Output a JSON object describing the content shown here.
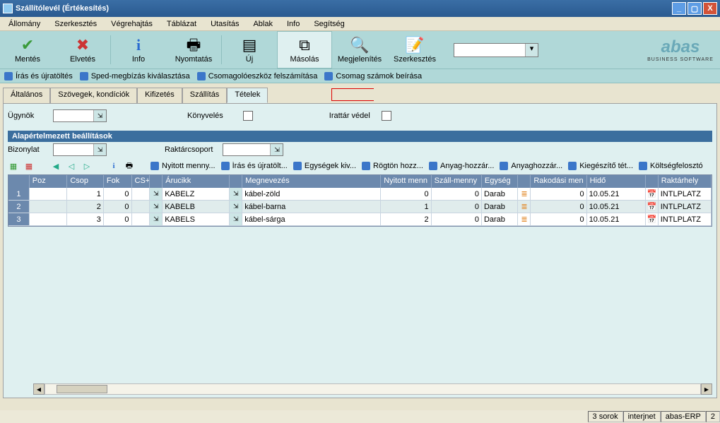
{
  "window": {
    "title": "Szállítólevél (Értékesítés)"
  },
  "menu": {
    "items": [
      "Állomány",
      "Szerkesztés",
      "Végrehajtás",
      "Táblázat",
      "Utasítás",
      "Ablak",
      "Info",
      "Segítség"
    ]
  },
  "toolbar": {
    "save": "Mentés",
    "discard": "Elvetés",
    "info": "Info",
    "print": "Nyomtatás",
    "new": "Új",
    "copy": "Másolás",
    "show": "Megjelenítés",
    "edit": "Szerkesztés"
  },
  "logo": {
    "brand": "abas",
    "sub": "BUSINESS SOFTWARE"
  },
  "ribbon": [
    "Írás és újratöltés",
    "Sped-megbízás kiválasztása",
    "Csomagolóeszköz felszámítása",
    "Csomag számok beírása"
  ],
  "tabs": {
    "items": [
      "Általános",
      "Szövegek, kondíciók",
      "Kifizetés",
      "Szállítás",
      "Tételek"
    ],
    "activeIndex": 4
  },
  "form": {
    "agent_label": "Ügynök",
    "agent_value": "",
    "booking_label": "Könyvelés",
    "archive_label": "Irattár védel",
    "section": "Alapértelmezett beállítások",
    "doc_label": "Bizonylat",
    "doc_value": "",
    "wh_label": "Raktárcsoport",
    "wh_value": ""
  },
  "gridlinks": [
    "Nyitott menny...",
    "Írás és újratölt...",
    "Egységek kiv...",
    "Rögtön hozz...",
    "Anyag-hozzár...",
    "Anyaghozzár...",
    "Kiegészítő tét...",
    "Költségfelosztó"
  ],
  "columns": {
    "poz": "Poz",
    "csop": "Csop",
    "fok": "Fok",
    "cs": "CS+",
    "art": "Árucikk",
    "meg": "Megnevezés",
    "ny": "Nyitott menn",
    "sz": "Száll-menny",
    "egy": "Egység",
    "rak": "Rakodási men",
    "hido": "Hidő",
    "rakhely": "Raktárhely"
  },
  "rows": [
    {
      "n": "1",
      "poz": "",
      "csop": "1",
      "fok": "0",
      "art": "KABELZ",
      "meg": "kábel-zöld",
      "ny": "0",
      "sz": "0",
      "egy": "Darab",
      "rak": "0",
      "hido": "10.05.21",
      "rakhely": "INTLPLATZ"
    },
    {
      "n": "2",
      "poz": "",
      "csop": "2",
      "fok": "0",
      "art": "KABELB",
      "meg": "kábel-barna",
      "ny": "1",
      "sz": "0",
      "egy": "Darab",
      "rak": "0",
      "hido": "10.05.21",
      "rakhely": "INTLPLATZ"
    },
    {
      "n": "3",
      "poz": "",
      "csop": "3",
      "fok": "0",
      "art": "KABELS",
      "meg": "kábel-sárga",
      "ny": "2",
      "sz": "0",
      "egy": "Darab",
      "rak": "0",
      "hido": "10.05.21",
      "rakhely": "INTLPLATZ"
    }
  ],
  "status": {
    "rows": "3 sorok",
    "net": "interjnet",
    "prod": "abas-ERP",
    "num": "2"
  }
}
